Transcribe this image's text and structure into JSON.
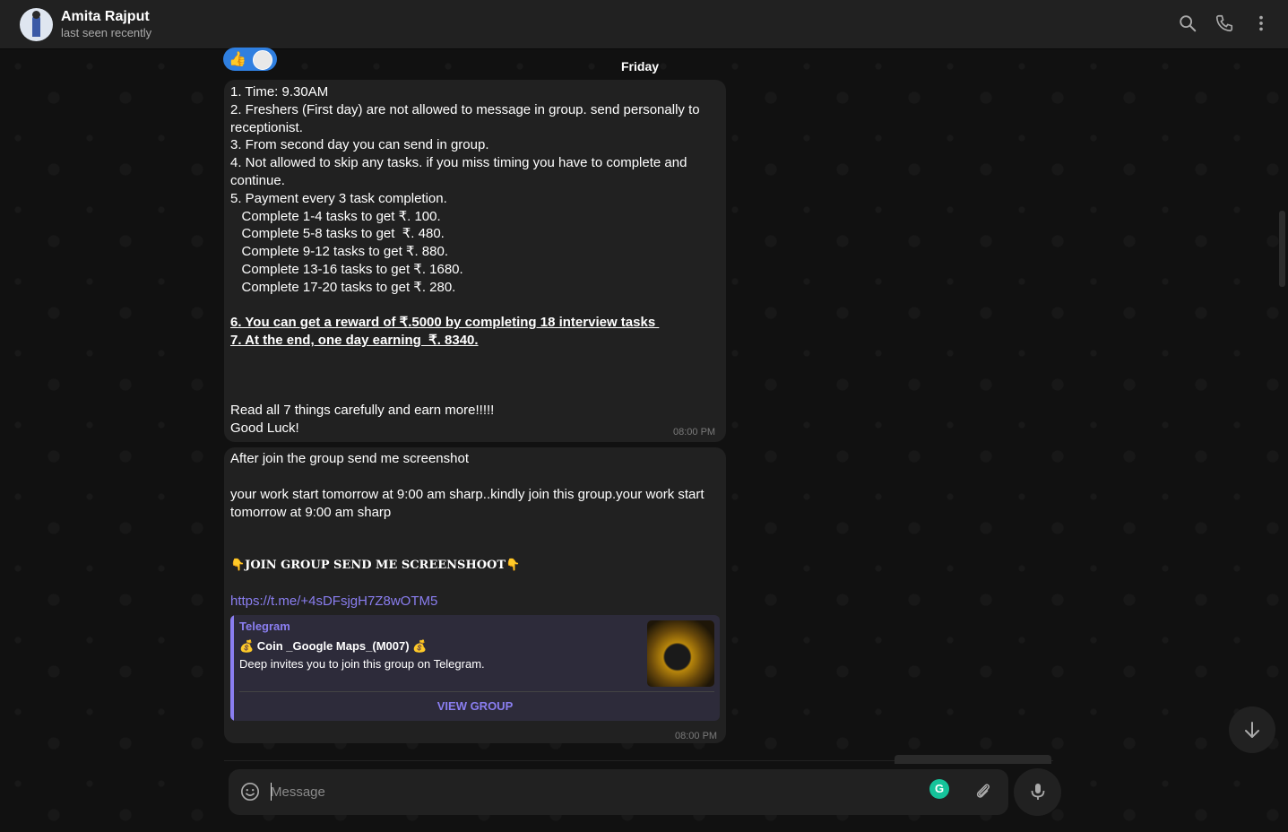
{
  "header": {
    "name": "Amita Rajput",
    "status": "last seen recently"
  },
  "reactions": {
    "emoji": "👍"
  },
  "date_label": "Friday",
  "message1": {
    "lines": [
      "1. Time: 9.30AM",
      "2. Freshers (First day) are not allowed to message in group. send personally to",
      "receptionist.",
      "3. From second day you can send in group.",
      "4. Not allowed to skip any tasks. if you miss timing you have to complete and",
      "continue.",
      "5. Payment every 3 task completion.",
      "   Complete 1-4 tasks to get ₹. 100.",
      "   Complete 5-8 tasks to get  ₹. 480.",
      "   Complete 9-12 tasks to get ₹. 880.",
      "   Complete 13-16 tasks to get ₹. 1680.",
      "   Complete 17-20 tasks to get ₹. 280."
    ],
    "underlined": [
      "6. You can get a reward of ₹.5000 by completing 18 interview tasks ",
      "7. At the end, one day earning  ₹. 8340."
    ],
    "closing": [
      "Read all 7 things carefully and earn more!!!!!",
      "Good Luck!"
    ],
    "time": "08:00 PM"
  },
  "message2": {
    "line1": "After join the group send me screenshot",
    "line2": "your work start tomorrow at 9:00 am sharp..kindly join this group.your work start",
    "line3": "tomorrow at 9:00 am sharp",
    "join_text": "👇JOIN GROUP SEND ME SCREENSHOOT👇",
    "link": "https://t.me/+4sDFsjgH7Z8wOTM5",
    "preview": {
      "source": "Telegram",
      "name": "💰 Coin _Google Maps_(M007) 💰",
      "description": "Deep invites you to join this group on Telegram.",
      "button": "VIEW GROUP"
    },
    "time": "08:00 PM"
  },
  "composer": {
    "placeholder": "Message",
    "grammarly": "G"
  },
  "icons": {
    "search": "search-icon",
    "call": "phone-icon",
    "menu": "more-vertical-icon",
    "emoji": "smiley-icon",
    "attach": "paperclip-icon",
    "mic": "microphone-icon",
    "scroll": "arrow-down-icon"
  },
  "colors": {
    "bubble": "#212121",
    "accent": "#8a7ef0",
    "reaction": "#2f7fe0",
    "grammarly": "#15c39a"
  }
}
